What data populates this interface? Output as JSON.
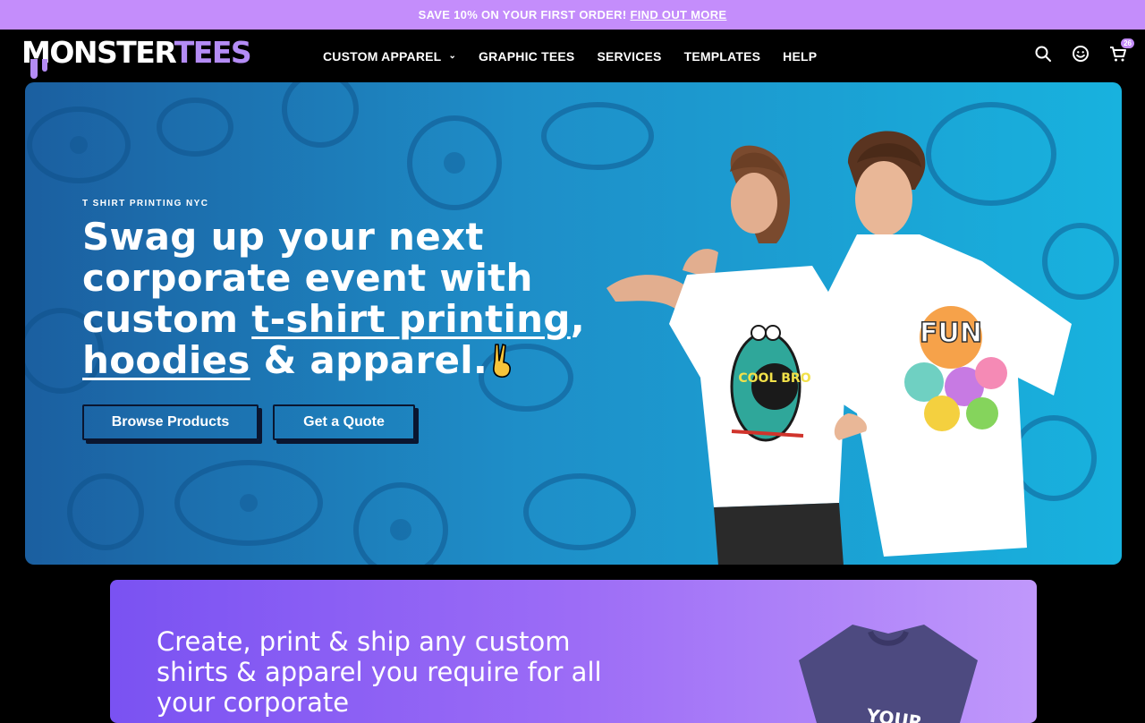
{
  "promo": {
    "text": "SAVE 10% ON YOUR FIRST ORDER!",
    "link": "FIND OUT MORE"
  },
  "brand": {
    "part1": "MONSTER",
    "part2": "TEES"
  },
  "nav": {
    "items": [
      {
        "label": "CUSTOM APPAREL"
      },
      {
        "label": "GRAPHIC TEES"
      },
      {
        "label": "SERVICES"
      },
      {
        "label": "TEMPLATES"
      },
      {
        "label": "HELP"
      }
    ],
    "cart_count": "26",
    "icons": [
      "search-icon",
      "account-icon",
      "cart-icon"
    ]
  },
  "hero": {
    "eyebrow": "T SHIRT PRINTING NYC",
    "line1": "Swag up your next",
    "line2": "corporate event with",
    "line3_a": "custom ",
    "line3_link": "t-shirt printing",
    "line3_b": ",",
    "line4_link": "hoodies",
    "line4_b": " & apparel.",
    "btn_browse": "Browse Products",
    "btn_quote": "Get a Quote",
    "tee_left": "COOL BRO",
    "tee_right": "FUN"
  },
  "promo_card": {
    "text": "Create, print & ship any custom shirts & apparel you require for all your corporate",
    "shirt_text": "YOUR"
  },
  "colors": {
    "accent": "#c48dfb",
    "hero_blue": "#1e8ec8",
    "card_purple": "#8b5cf6"
  }
}
